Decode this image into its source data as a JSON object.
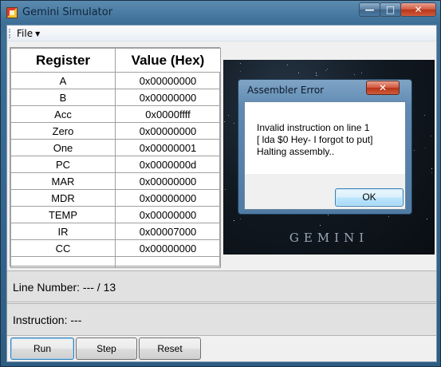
{
  "window": {
    "title": "Gemini Simulator",
    "min_glyph": "—",
    "max_glyph": "□",
    "close_glyph": "✕"
  },
  "menu": {
    "file_label": "File"
  },
  "registers": {
    "headers": [
      "Register",
      "Value (Hex)"
    ],
    "rows": [
      [
        "A",
        "0x00000000"
      ],
      [
        "B",
        "0x00000000"
      ],
      [
        "Acc",
        "0x0000ffff"
      ],
      [
        "Zero",
        "0x00000000"
      ],
      [
        "One",
        "0x00000001"
      ],
      [
        "PC",
        "0x0000000d"
      ],
      [
        "MAR",
        "0x00000000"
      ],
      [
        "MDR",
        "0x00000000"
      ],
      [
        "TEMP",
        "0x00000000"
      ],
      [
        "IR",
        "0x00007000"
      ],
      [
        "CC",
        "0x00000000"
      ]
    ]
  },
  "logo": {
    "text": "GEMINI"
  },
  "dialog": {
    "title": "Assembler Error",
    "close_glyph": "✕",
    "message_lines": [
      "Invalid instruction on line 1",
      "[  lda $0  Hey- I forgot to put]",
      "Halting assembly.."
    ],
    "ok_label": "OK"
  },
  "status": {
    "line_number": "Line Number:  --- / 13",
    "instruction": "Instruction: ---"
  },
  "buttons": {
    "run": "Run",
    "step": "Step",
    "reset": "Reset"
  }
}
